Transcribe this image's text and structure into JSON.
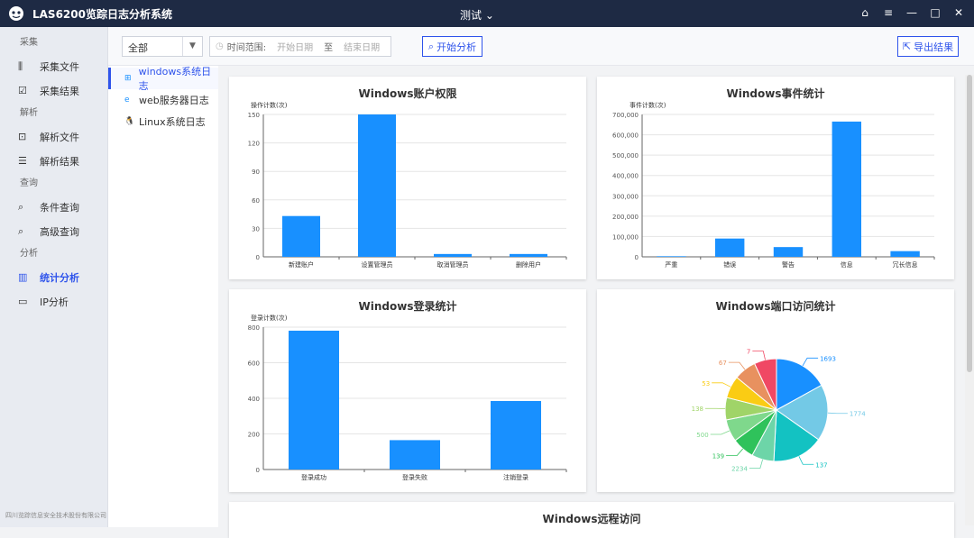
{
  "app": {
    "title": "LAS6200览踪日志分析系统",
    "project": "测试 ⌄"
  },
  "sidebar": {
    "sections": [
      {
        "title": "采集",
        "items": [
          "采集文件",
          "采集结果"
        ]
      },
      {
        "title": "解析",
        "items": [
          "解析文件",
          "解析结果"
        ]
      },
      {
        "title": "查询",
        "items": [
          "条件查询",
          "高级查询"
        ]
      },
      {
        "title": "分析",
        "items": [
          "统计分析",
          "IP分析"
        ]
      }
    ],
    "active": "统计分析",
    "company": "四川览踪信息安全技术股份有限公司"
  },
  "toolbar": {
    "select_value": "全部",
    "range_label": "时间范围:",
    "start_ph": "开始日期",
    "to": "至",
    "end_ph": "结束日期",
    "analyze_label": "开始分析",
    "export_label": "导出结果"
  },
  "subnav": {
    "items": [
      "windows系统日志",
      "web服务器日志",
      "Linux系统日志"
    ],
    "active": 0
  },
  "chart_data": [
    {
      "type": "bar",
      "title": "Windows账户权限",
      "ylabel": "操作计数(次)",
      "categories": [
        "新建账户",
        "设置管理员",
        "取消管理员",
        "删除用户"
      ],
      "values": [
        43,
        150,
        3,
        3
      ],
      "ylim": [
        0,
        150
      ],
      "yticks": [
        0,
        30,
        60,
        90,
        120,
        150
      ]
    },
    {
      "type": "bar",
      "title": "Windows事件统计",
      "ylabel": "事件计数(次)",
      "categories": [
        "严重",
        "错误",
        "警告",
        "信息",
        "冗长信息"
      ],
      "values": [
        3000,
        90000,
        48000,
        665000,
        28000
      ],
      "ylim": [
        0,
        700000
      ],
      "yticks": [
        "0",
        "100,000",
        "200,000",
        "300,000",
        "400,000",
        "500,000",
        "600,000",
        "700,000"
      ]
    },
    {
      "type": "bar",
      "title": "Windows登录统计",
      "ylabel": "登录计数(次)",
      "categories": [
        "登录成功",
        "登录失败",
        "注销登录"
      ],
      "values": [
        780,
        165,
        385
      ],
      "ylim": [
        0,
        800
      ],
      "yticks": [
        0,
        200,
        400,
        600,
        800
      ]
    },
    {
      "type": "pie",
      "title": "Windows端口访问统计",
      "slices": [
        {
          "label": "1693",
          "value": 1693,
          "color": "#1890ff"
        },
        {
          "label": "1774",
          "value": 1774,
          "color": "#73c9e6"
        },
        {
          "label": "137",
          "value": 1600,
          "color": "#13c2c2"
        },
        {
          "label": "2234",
          "value": 700,
          "color": "#6dd5a8"
        },
        {
          "label": "139",
          "value": 700,
          "color": "#2fc25b"
        },
        {
          "label": "500",
          "value": 700,
          "color": "#7fd88c"
        },
        {
          "label": "138",
          "value": 700,
          "color": "#a0d468"
        },
        {
          "label": "53",
          "value": 700,
          "color": "#facc14"
        },
        {
          "label": "67",
          "value": 700,
          "color": "#e8915f"
        },
        {
          "label": "7",
          "value": 700,
          "color": "#f04864"
        }
      ]
    }
  ],
  "bottom_card_title": "Windows远程访问",
  "colors": {
    "bar": "#1890ff",
    "accent": "#2f54eb",
    "titlebar": "#1e2a44"
  }
}
